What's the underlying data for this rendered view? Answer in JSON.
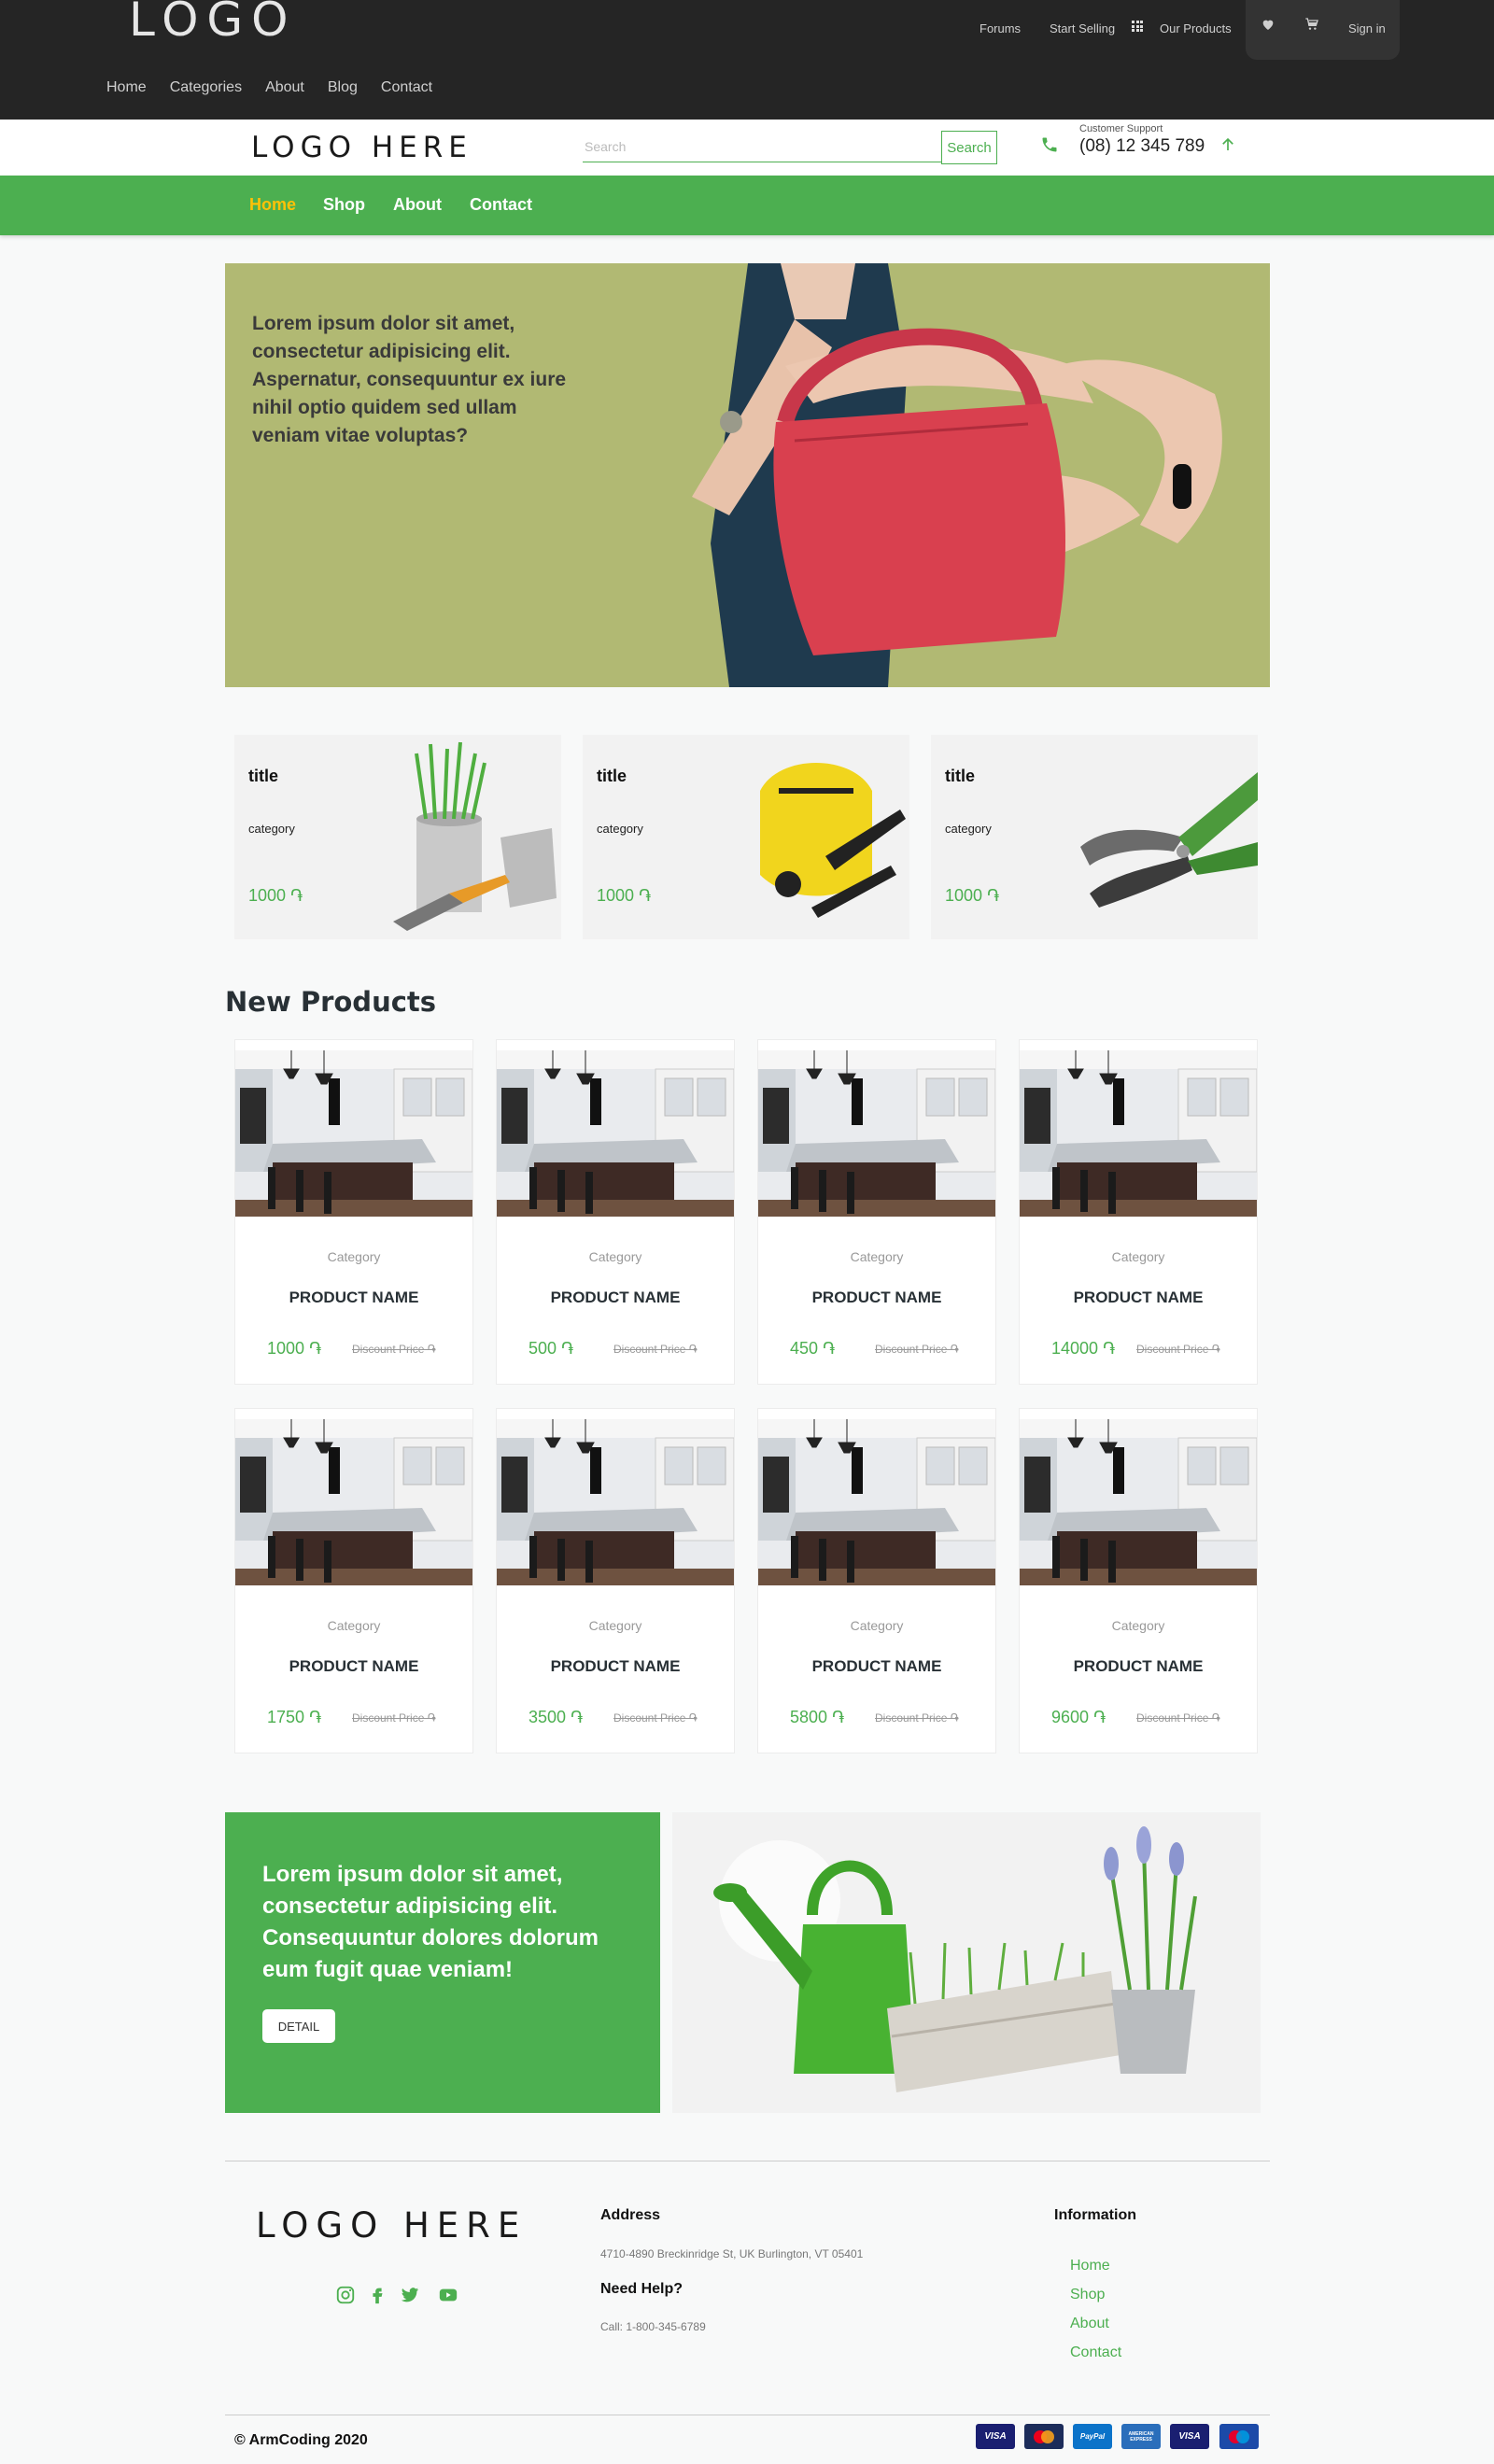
{
  "topbar": {
    "logo": "LOGO",
    "nav": [
      "Home",
      "Categories",
      "About",
      "Blog",
      "Contact"
    ],
    "forums": "Forums",
    "start_selling": "Start Selling",
    "our_products": "Our Products",
    "sign_in": "Sign in"
  },
  "header": {
    "logo": "LOGO HERE",
    "search_placeholder": "Search",
    "search_button": "Search",
    "support_label": "Customer Support",
    "support_phone": "(08) 12 345 789"
  },
  "greennav": {
    "items": [
      "Home",
      "Shop",
      "About",
      "Contact"
    ],
    "active": "Home"
  },
  "hero": {
    "text": "Lorem ipsum dolor sit amet, consectetur adipisicing elit. Aspernatur, consequuntur ex iure nihil optio quidem sed ullam veniam vitae voluptas?"
  },
  "features": [
    {
      "title": "title",
      "category": "category",
      "price": "1000 ֏"
    },
    {
      "title": "title",
      "category": "category",
      "price": "1000 ֏"
    },
    {
      "title": "title",
      "category": "category",
      "price": "1000 ֏"
    }
  ],
  "new_products": {
    "title": "New Products",
    "items": [
      {
        "category": "Category",
        "name": "PRODUCT NAME",
        "price": "1000 ֏",
        "discount": "Discount Price ֏"
      },
      {
        "category": "Category",
        "name": "PRODUCT NAME",
        "price": "500 ֏",
        "discount": "Discount Price ֏"
      },
      {
        "category": "Category",
        "name": "PRODUCT NAME",
        "price": "450 ֏",
        "discount": "Discount Price ֏"
      },
      {
        "category": "Category",
        "name": "PRODUCT NAME",
        "price": "14000 ֏",
        "discount": "Discount Price ֏"
      },
      {
        "category": "Category",
        "name": "PRODUCT NAME",
        "price": "1750 ֏",
        "discount": "Discount Price ֏"
      },
      {
        "category": "Category",
        "name": "PRODUCT NAME",
        "price": "3500 ֏",
        "discount": "Discount Price ֏"
      },
      {
        "category": "Category",
        "name": "PRODUCT NAME",
        "price": "5800 ֏",
        "discount": "Discount Price ֏"
      },
      {
        "category": "Category",
        "name": "PRODUCT NAME",
        "price": "9600 ֏",
        "discount": "Discount Price ֏"
      }
    ]
  },
  "promo": {
    "text": "Lorem ipsum dolor sit amet, consectetur adipisicing elit. Consequuntur dolores dolorum eum fugit quae veniam!",
    "button": "DETAIL"
  },
  "footer": {
    "logo": "LOGO HERE",
    "address_title": "Address",
    "address": "4710-4890 Breckinridge St, UK Burlington, VT 05401",
    "help_title": "Need Help?",
    "help": "Call: 1-800-345-6789",
    "info_title": "Information",
    "links": [
      "Home",
      "Shop",
      "About",
      "Contact"
    ],
    "copyright": "© ArmCoding 2020",
    "payments": [
      "VISA",
      "mastercard",
      "PayPal",
      "AMERICAN EXPRESS",
      "VISA",
      "maestro"
    ]
  },
  "colors": {
    "accent": "#4caf50",
    "active_nav": "#ffc107",
    "hero_bg": "#b1b973",
    "topbar_bg": "#252525"
  }
}
